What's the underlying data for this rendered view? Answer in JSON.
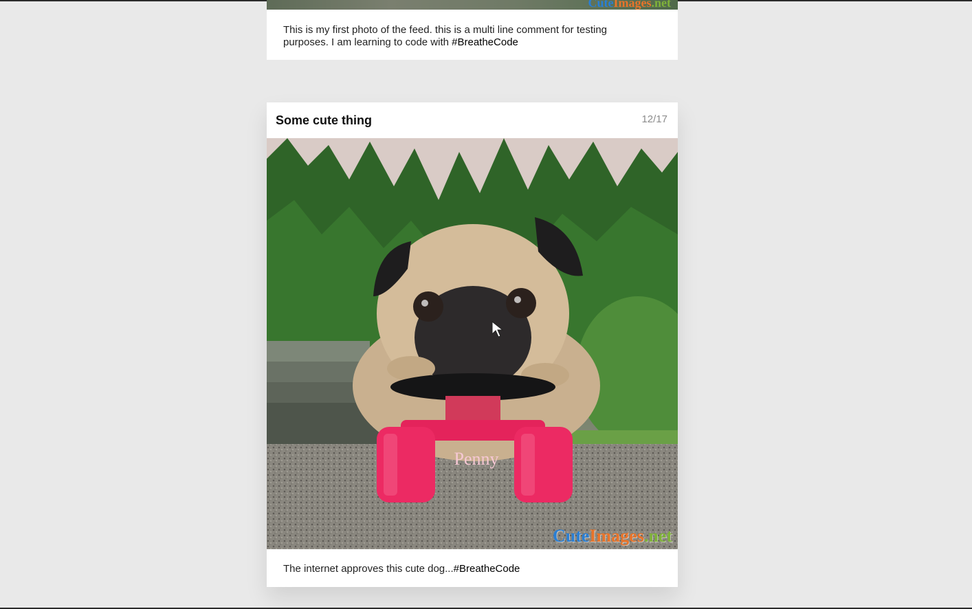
{
  "feed": {
    "posts": [
      {
        "caption_text": "This is my first photo of the feed. this is a multi line comment for testing purposes. I am learning to code with ",
        "hashtag": "#BreatheCode",
        "watermark": {
          "cute": "Cute",
          "images": "Images",
          "net": ".net"
        }
      },
      {
        "title": "Some cute thing",
        "counter": "12/17",
        "image_text": "Penny",
        "caption_text": "The internet approves this cute dog...",
        "hashtag": "#BreatheCode",
        "watermark": {
          "cute": "Cute",
          "images": "Images",
          "net": ".net"
        }
      }
    ]
  },
  "colors": {
    "background": "#e9e9e9",
    "card": "#ffffff",
    "counter": "#8c8c8c",
    "skateboard": "#e8235a"
  }
}
